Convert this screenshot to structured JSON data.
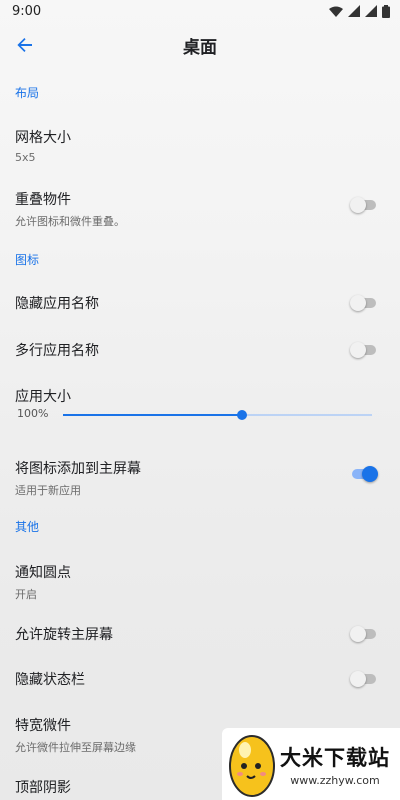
{
  "status_bar": {
    "time": "9:00",
    "icons": [
      "wifi-icon",
      "lte-signal-icon",
      "signal-icon",
      "battery-icon"
    ]
  },
  "app_bar": {
    "title": "桌面",
    "back_icon": "arrow-back-icon"
  },
  "sections": {
    "layout": "布局",
    "icons": "图标",
    "other": "其他"
  },
  "settings": {
    "grid_size": {
      "title": "网格大小",
      "value": "5x5"
    },
    "overlap_widgets": {
      "title": "重叠物件",
      "summary": "允许图标和微件重叠。",
      "checked": false
    },
    "hide_app_names": {
      "title": "隐藏应用名称",
      "checked": false
    },
    "multiline_app_names": {
      "title": "多行应用名称",
      "checked": false
    },
    "app_size": {
      "title": "应用大小",
      "value_label": "100%",
      "fraction": 0.58
    },
    "add_icon_home": {
      "title": "将图标添加到主屏幕",
      "summary": "适用于新应用",
      "checked": true
    },
    "notification_dots": {
      "title": "通知圆点",
      "value": "开启"
    },
    "allow_rotation": {
      "title": "允许旋转主屏幕",
      "checked": false
    },
    "hide_status_bar": {
      "title": "隐藏状态栏",
      "checked": false
    },
    "wide_widgets": {
      "title": "特宽微件",
      "summary": "允许微件拉伸至屏幕边缘",
      "checked": false
    },
    "top_shadow": {
      "title": "顶部阴影"
    }
  },
  "watermark": {
    "title": "大米下载站",
    "url": "www.zzhyw.com"
  },
  "colors": {
    "accent": "#1a73e8",
    "switch_off_track": "#bdbdbd"
  }
}
